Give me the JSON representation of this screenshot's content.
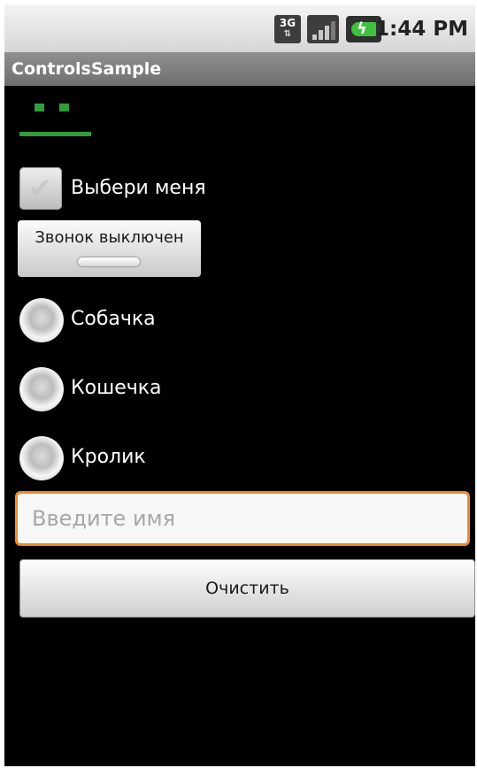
{
  "status_bar": {
    "network_label": "3G",
    "time": "1:44 PM",
    "icons": [
      "3g-network-icon",
      "signal-strength-icon",
      "battery-charging-icon"
    ],
    "battery_color": "#3fc13f"
  },
  "app": {
    "title": "ControlsSample"
  },
  "tabs": {
    "accent_color": "#2f9e3b"
  },
  "checkbox": {
    "label": "Выбери меня",
    "checked": false
  },
  "toggle": {
    "label": "Звонок выключен",
    "on": false
  },
  "radios": [
    {
      "label": "Собачка"
    },
    {
      "label": "Кошечка"
    },
    {
      "label": "Кролик"
    }
  ],
  "name_input": {
    "placeholder": "Введите имя",
    "value": "",
    "focus_color": "#f0892a"
  },
  "clear_button": {
    "label": "Очистить"
  }
}
